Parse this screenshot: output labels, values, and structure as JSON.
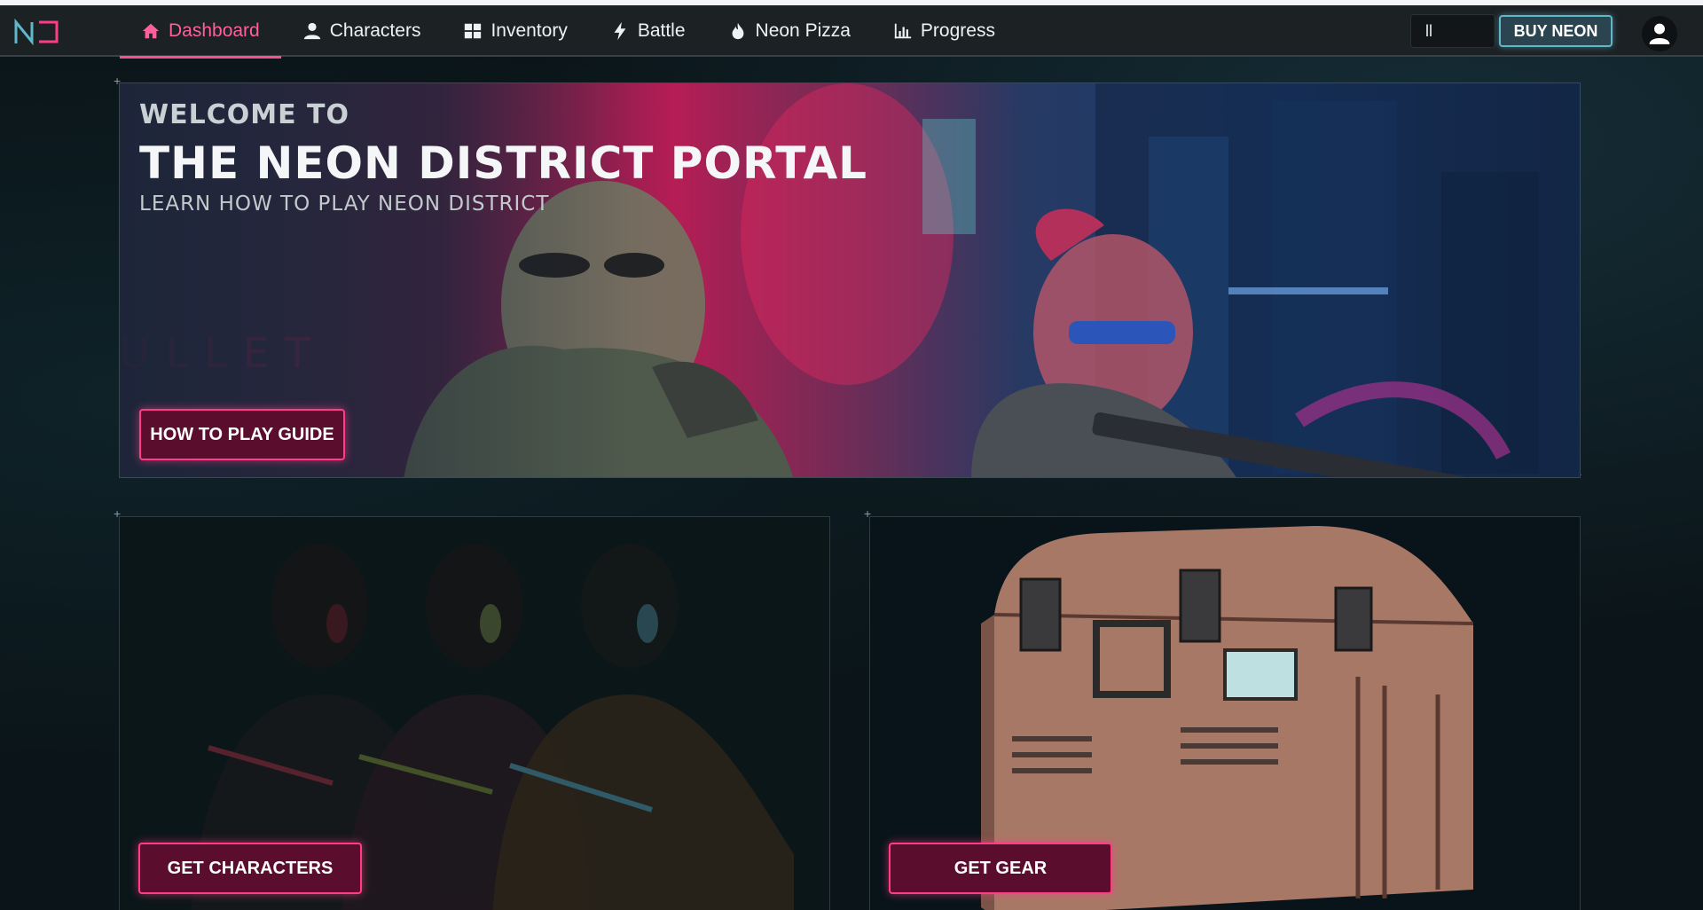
{
  "nav": {
    "items": [
      {
        "label": "Dashboard",
        "icon": "home-icon",
        "active": true
      },
      {
        "label": "Characters",
        "icon": "user-icon",
        "active": false
      },
      {
        "label": "Inventory",
        "icon": "grid-icon",
        "active": false
      },
      {
        "label": "Battle",
        "icon": "lightning-icon",
        "active": false
      },
      {
        "label": "Neon Pizza",
        "icon": "flame-icon",
        "active": false
      },
      {
        "label": "Progress",
        "icon": "bar-chart-icon",
        "active": false
      }
    ]
  },
  "header": {
    "balance_value": "ll",
    "buy_label": "BUY NEON"
  },
  "hero": {
    "welcome": "WELCOME TO",
    "title": "THE NEON DISTRICT PORTAL",
    "subtitle": "LEARN HOW TO PLAY NEON DISTRICT",
    "cta_label": "HOW TO PLAY GUIDE"
  },
  "cards": {
    "characters_cta": "GET CHARACTERS",
    "gear_cta": "GET GEAR"
  },
  "colors": {
    "accent_pink": "#ff4f8f",
    "accent_teal": "#5fb7c9",
    "background": "#0b1519"
  }
}
